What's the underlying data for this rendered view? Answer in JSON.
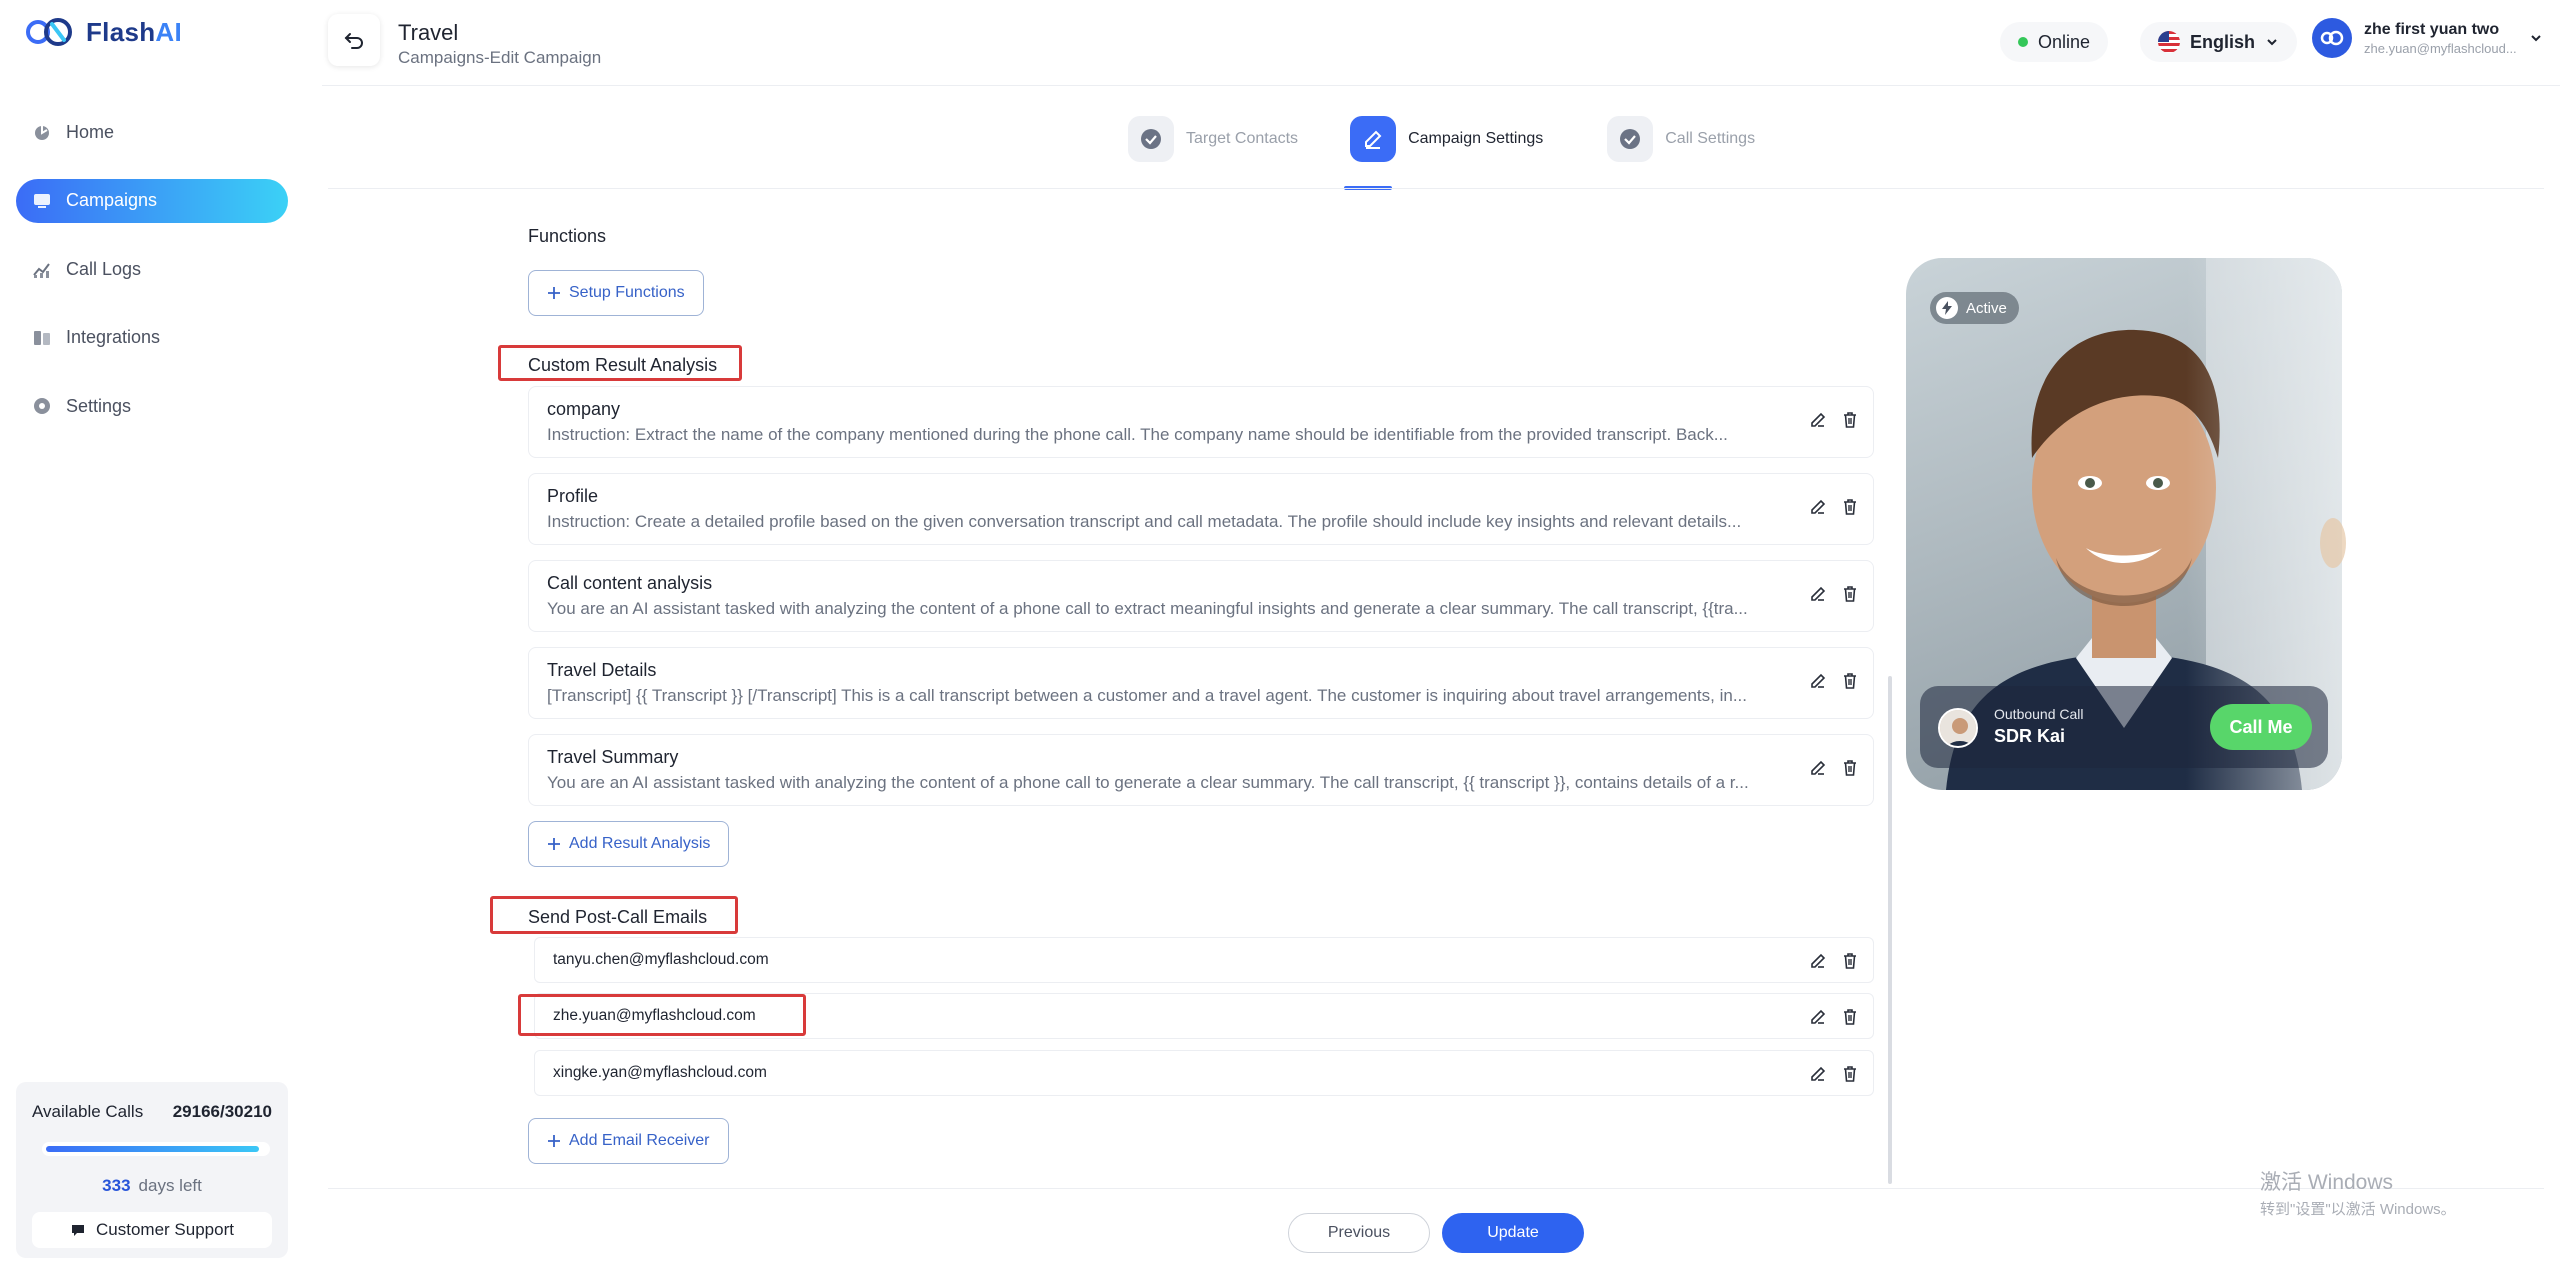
{
  "brand": {
    "name_part1": "Flash",
    "name_part2": "AI"
  },
  "sidebar": {
    "items": [
      {
        "label": "Home",
        "icon": "home-icon"
      },
      {
        "label": "Campaigns",
        "icon": "campaigns-icon",
        "active": true
      },
      {
        "label": "Call Logs",
        "icon": "call-logs-icon"
      },
      {
        "label": "Integrations",
        "icon": "integrations-icon"
      },
      {
        "label": "Settings",
        "icon": "settings-icon"
      }
    ],
    "available_calls_label": "Available Calls",
    "available_calls_value": "29166/30210",
    "usage_fraction": 0.966,
    "days_left_number": "333",
    "days_left_label": "days left",
    "support_label": "Customer Support"
  },
  "header": {
    "title": "Travel",
    "subtitle": "Campaigns-Edit Campaign",
    "status": "Online",
    "language": "English",
    "user_name": "zhe first yuan two",
    "user_email": "zhe.yuan@myflashcloud..."
  },
  "steps": [
    {
      "label": "Target Contacts",
      "state": "done"
    },
    {
      "label": "Campaign Settings",
      "state": "active"
    },
    {
      "label": "Call Settings",
      "state": "done"
    }
  ],
  "functions": {
    "label": "Functions",
    "setup_button": "Setup Functions"
  },
  "result_analysis": {
    "label": "Custom Result Analysis",
    "items": [
      {
        "title": "company",
        "desc": "Instruction: Extract the name of the company mentioned during the phone call. The company name should be identifiable from the provided transcript. Back..."
      },
      {
        "title": "Profile",
        "desc": "Instruction: Create a detailed profile based on the given conversation transcript and call metadata. The profile should include key insights and relevant details..."
      },
      {
        "title": "Call content analysis",
        "desc": "You are an AI assistant tasked with analyzing the content of a phone call to extract meaningful insights and generate a clear summary. The call transcript, {{tra..."
      },
      {
        "title": "Travel Details",
        "desc": "[Transcript] {{ Transcript }} [/Transcript] This is a call transcript between a customer and a travel agent. The customer is inquiring about travel arrangements, in..."
      },
      {
        "title": "Travel Summary",
        "desc": "You are an AI assistant tasked with analyzing the content of a phone call to generate a clear summary. The call transcript, {{ transcript }}, contains details of a r..."
      }
    ],
    "add_button": "Add Result Analysis"
  },
  "post_call_emails": {
    "label": "Send Post-Call Emails",
    "emails": [
      "tanyu.chen@myflashcloud.com",
      "zhe.yuan@myflashcloud.com",
      "xingke.yan@myflashcloud.com"
    ],
    "add_button": "Add Email Receiver"
  },
  "preview": {
    "status": "Active",
    "call_type": "Outbound Call",
    "agent_name": "SDR Kai",
    "call_button": "Call Me"
  },
  "footer": {
    "previous": "Previous",
    "update": "Update"
  },
  "watermark": {
    "line1": "激活 Windows",
    "line2": "转到\"设置\"以激活 Windows。"
  },
  "colors": {
    "accent": "#3b6cf6",
    "highlight_box": "#d83a3a",
    "call_button": "#58d66a"
  }
}
